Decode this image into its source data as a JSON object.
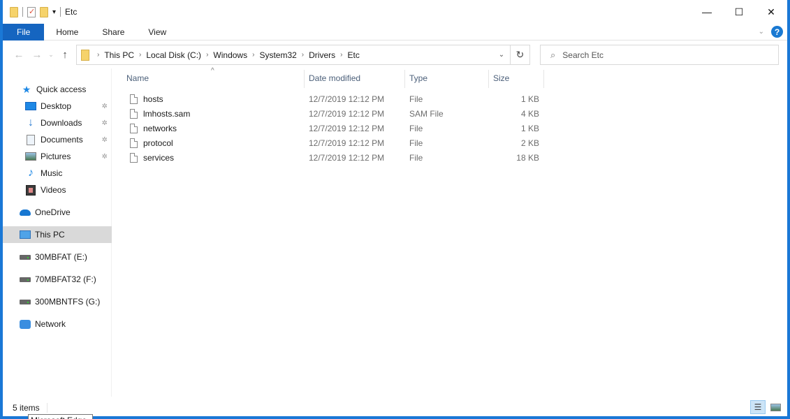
{
  "window": {
    "title": "Etc",
    "controls": {
      "minimize": "—",
      "maximize": "☐",
      "close": "✕"
    }
  },
  "quick_access_toolbar": {
    "icons": [
      "folder-icon",
      "properties-icon",
      "new-folder-icon",
      "customize-dropdown-icon"
    ]
  },
  "ribbon": {
    "tabs": [
      {
        "label": "File",
        "active": true
      },
      {
        "label": "Home"
      },
      {
        "label": "Share"
      },
      {
        "label": "View"
      }
    ],
    "help": "?",
    "expand": "⌄"
  },
  "navigation": {
    "back": "←",
    "forward": "→",
    "recent": "⌄",
    "up": "↑",
    "breadcrumb": [
      "This PC",
      "Local Disk (C:)",
      "Windows",
      "System32",
      "Drivers",
      "Etc"
    ],
    "crumb_separator": "›",
    "dropdown": "⌄",
    "refresh": "↻",
    "search_placeholder": "Search Etc",
    "search_value": ""
  },
  "sidebar": {
    "items": [
      {
        "label": "Quick access",
        "icon": "star-icon",
        "pinned": false
      },
      {
        "label": "Desktop",
        "icon": "desktop-icon",
        "pinned": true
      },
      {
        "label": "Downloads",
        "icon": "download-icon",
        "pinned": true
      },
      {
        "label": "Documents",
        "icon": "documents-icon",
        "pinned": true
      },
      {
        "label": "Pictures",
        "icon": "pictures-icon",
        "pinned": true
      },
      {
        "label": "Music",
        "icon": "music-icon",
        "pinned": false
      },
      {
        "label": "Videos",
        "icon": "videos-icon",
        "pinned": false
      },
      {
        "label": "OneDrive",
        "icon": "onedrive-icon",
        "pinned": false
      },
      {
        "label": "This PC",
        "icon": "this-pc-icon",
        "pinned": false,
        "selected": true
      },
      {
        "label": "30MBFAT (E:)",
        "icon": "drive-icon",
        "pinned": false
      },
      {
        "label": "70MBFAT32 (F:)",
        "icon": "drive-icon",
        "pinned": false
      },
      {
        "label": "300MBNTFS (G:)",
        "icon": "drive-icon",
        "pinned": false
      },
      {
        "label": "Network",
        "icon": "network-icon",
        "pinned": false
      }
    ],
    "pin_glyph": "📌"
  },
  "file_list": {
    "columns": [
      "Name",
      "Date modified",
      "Type",
      "Size"
    ],
    "sort_indicator": "^",
    "rows": [
      {
        "name": "hosts",
        "date": "12/7/2019 12:12 PM",
        "type": "File",
        "size": "1 KB"
      },
      {
        "name": "lmhosts.sam",
        "date": "12/7/2019 12:12 PM",
        "type": "SAM File",
        "size": "4 KB"
      },
      {
        "name": "networks",
        "date": "12/7/2019 12:12 PM",
        "type": "File",
        "size": "1 KB"
      },
      {
        "name": "protocol",
        "date": "12/7/2019 12:12 PM",
        "type": "File",
        "size": "2 KB"
      },
      {
        "name": "services",
        "date": "12/7/2019 12:12 PM",
        "type": "File",
        "size": "18 KB"
      }
    ]
  },
  "status_bar": {
    "item_count": "5 items",
    "views": [
      "details-view",
      "large-icons-view"
    ]
  },
  "tooltip": {
    "text": "Microsoft Edge"
  }
}
